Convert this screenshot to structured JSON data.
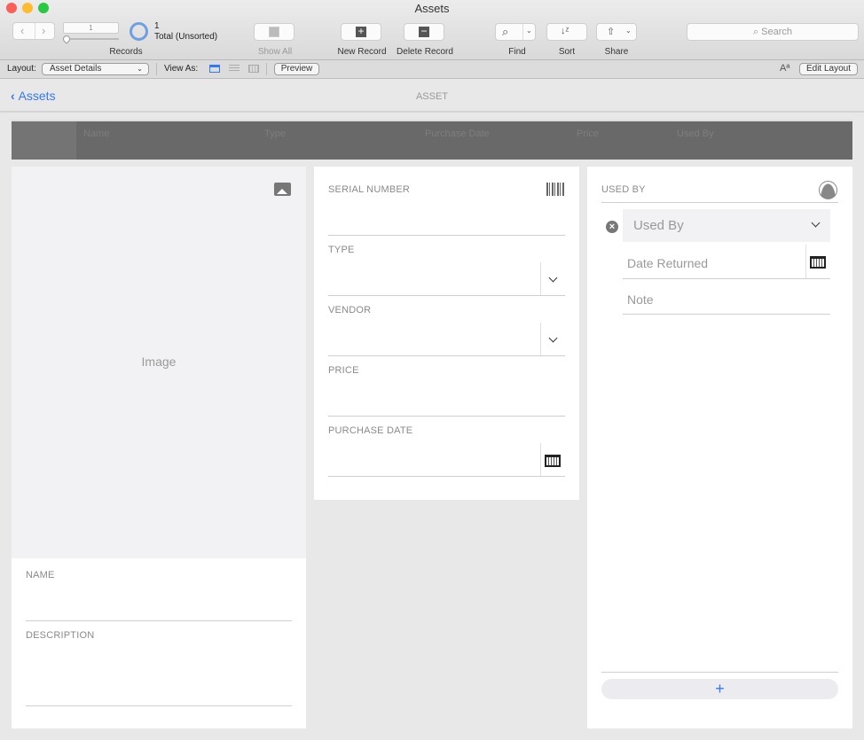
{
  "window": {
    "title": "Assets"
  },
  "toolbar": {
    "record_number": "1",
    "records_count": "1",
    "records_status": "Total (Unsorted)",
    "records_label": "Records",
    "show_all": "Show All",
    "new_record": "New Record",
    "delete_record": "Delete Record",
    "find": "Find",
    "sort": "Sort",
    "share": "Share",
    "search_placeholder": "Search"
  },
  "layoutbar": {
    "layout_label": "Layout:",
    "layout_value": "Asset Details",
    "view_as": "View As:",
    "preview": "Preview",
    "edit_layout": "Edit Layout",
    "font_icon": "Aª"
  },
  "nav": {
    "back": "Assets",
    "title": "ASSET"
  },
  "grid": {
    "columns": [
      "Name",
      "Type",
      "Purchase Date",
      "Price",
      "Used By"
    ]
  },
  "left": {
    "image_placeholder": "Image",
    "name_label": "NAME",
    "description_label": "DESCRIPTION"
  },
  "middle": {
    "serial": "SERIAL NUMBER",
    "type": "TYPE",
    "vendor": "VENDOR",
    "price": "PRICE",
    "purchase_date": "PURCHASE DATE"
  },
  "right": {
    "title": "USED BY",
    "used_by_placeholder": "Used By",
    "date_returned_placeholder": "Date Returned",
    "note_placeholder": "Note",
    "add": "+"
  },
  "colors": {
    "accent": "#3478f6",
    "grid_header": "#696969"
  }
}
